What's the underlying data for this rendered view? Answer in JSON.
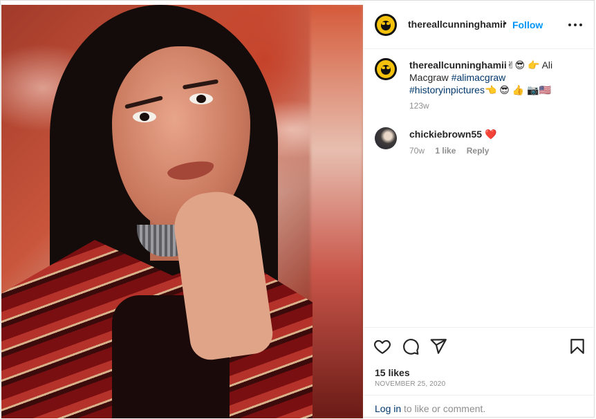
{
  "post": {
    "author": "thereallcunninghamii",
    "separator": "•",
    "follow_label": "Follow",
    "more_icon": "more-horizontal-icon",
    "photo_alt": "Portrait of Ali Macgraw",
    "caption": {
      "username": "thereallcunninghamii",
      "emoji_1": "✌😎 👉",
      "text": "Ali Macgraw",
      "hashtag_1": "#alimacgraw",
      "hashtag_2": "#historyinpictures",
      "emoji_2": "👈 😎 👍 📷🇺🇸",
      "time": "123w"
    },
    "comments": [
      {
        "username": "chickiebrown55",
        "emoji": "❤️",
        "time": "70w",
        "likes": "1 like",
        "reply_label": "Reply"
      }
    ],
    "likes": "15 likes",
    "date": "NOVEMBER 25, 2020",
    "footer": {
      "login_label": "Log in",
      "rest": " to like or comment."
    }
  },
  "icons": {
    "like": "heart-outline-icon",
    "comment": "comment-bubble-icon",
    "share": "paper-plane-icon",
    "save": "bookmark-icon"
  },
  "colors": {
    "accent": "#0095f6",
    "text": "#262626",
    "muted": "#8e8e8e",
    "link": "#00376b",
    "heart": "#ed4956"
  }
}
